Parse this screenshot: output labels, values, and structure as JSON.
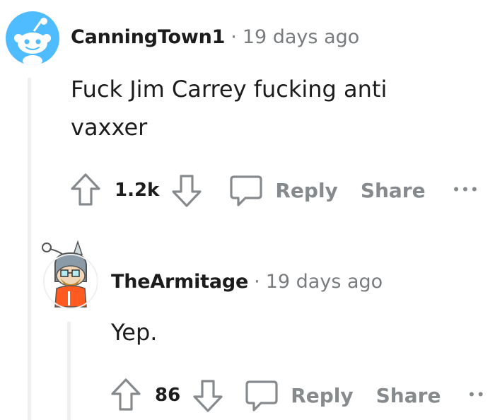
{
  "comments": [
    {
      "username": "CanningTown1",
      "separator": "·",
      "time": "19 days ago",
      "body_lines": [
        "Fuck Jim Carrey fucking anti",
        "vaxxer"
      ],
      "votes": "1.2k",
      "reply_label": "Reply",
      "share_label": "Share",
      "more_label": "•••"
    },
    {
      "username": "TheArmitage",
      "separator": "·",
      "time": "19 days ago",
      "body_lines": [
        "Yep."
      ],
      "votes": "86",
      "reply_label": "Reply",
      "share_label": "Share",
      "more_label": "••"
    }
  ],
  "colors": {
    "text": "#1c1c1c",
    "meta": "#787c7e",
    "action": "#878a8c",
    "avatar_blue": "#4fbcff",
    "thread_line": "#edeff1"
  }
}
